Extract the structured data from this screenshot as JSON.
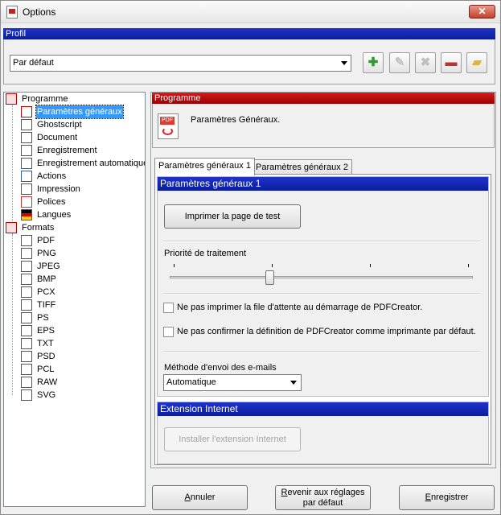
{
  "window": {
    "title": "Options",
    "close_glyph": "✕"
  },
  "profil": {
    "header": "Profil",
    "selected_profile": "Par défaut",
    "toolbar_icons": [
      "add-profile-icon",
      "rename-profile-icon",
      "delete-profile-icon",
      "save-profile-icon",
      "open-profile-icon"
    ],
    "toolbar_glyphs": [
      "✚",
      "✎",
      "✖",
      "▬",
      "▰"
    ],
    "colors": {
      "add": "#2a9d2a",
      "save": "#c0302f",
      "folder": "#e3b23c"
    }
  },
  "tree": {
    "programme_label": "Programme",
    "programme_items": [
      {
        "label": "Paramètres généraux",
        "icon": "settings-page-icon",
        "selected": true
      },
      {
        "label": "Ghostscript",
        "icon": "ghostscript-icon"
      },
      {
        "label": "Document",
        "icon": "document-icon"
      },
      {
        "label": "Enregistrement",
        "icon": "save-icon"
      },
      {
        "label": "Enregistrement automatique",
        "icon": "autosave-icon"
      },
      {
        "label": "Actions",
        "icon": "actions-icon"
      },
      {
        "label": "Impression",
        "icon": "printer-icon"
      },
      {
        "label": "Polices",
        "icon": "fonts-icon"
      },
      {
        "label": "Langues",
        "icon": "flag-icon"
      }
    ],
    "formats_label": "Formats",
    "format_items": [
      "PDF",
      "PNG",
      "JPEG",
      "BMP",
      "PCX",
      "TIFF",
      "PS",
      "EPS",
      "TXT",
      "PSD",
      "PCL",
      "RAW",
      "SVG"
    ]
  },
  "programme": {
    "header": "Programme",
    "title": "Paramètres Généraux."
  },
  "tabs": [
    "Paramètres généraux 1",
    "Paramètres généraux 2"
  ],
  "general": {
    "header": "Paramètres généraux 1",
    "print_test_page": "Imprimer la page de test",
    "priority_label": "Priorité de traitement",
    "priority_level_fraction": 0.33,
    "checkbox1": "Ne pas imprimer la file d'attente au démarrage de PDFCreator.",
    "checkbox2": "Ne pas confirmer la définition de PDFCreator comme imprimante par défaut.",
    "email_label": "Méthode d'envoi des e-mails",
    "email_value": "Automatique"
  },
  "internet": {
    "header": "Extension Internet",
    "install_button": "Installer l'extension Internet"
  },
  "footer": {
    "cancel_u": "A",
    "cancel_rest": "nnuler",
    "reset_u": "R",
    "reset_rest": "evenir aux réglages",
    "reset_line2": "par défaut",
    "save_u": "E",
    "save_rest": "nregistrer"
  }
}
